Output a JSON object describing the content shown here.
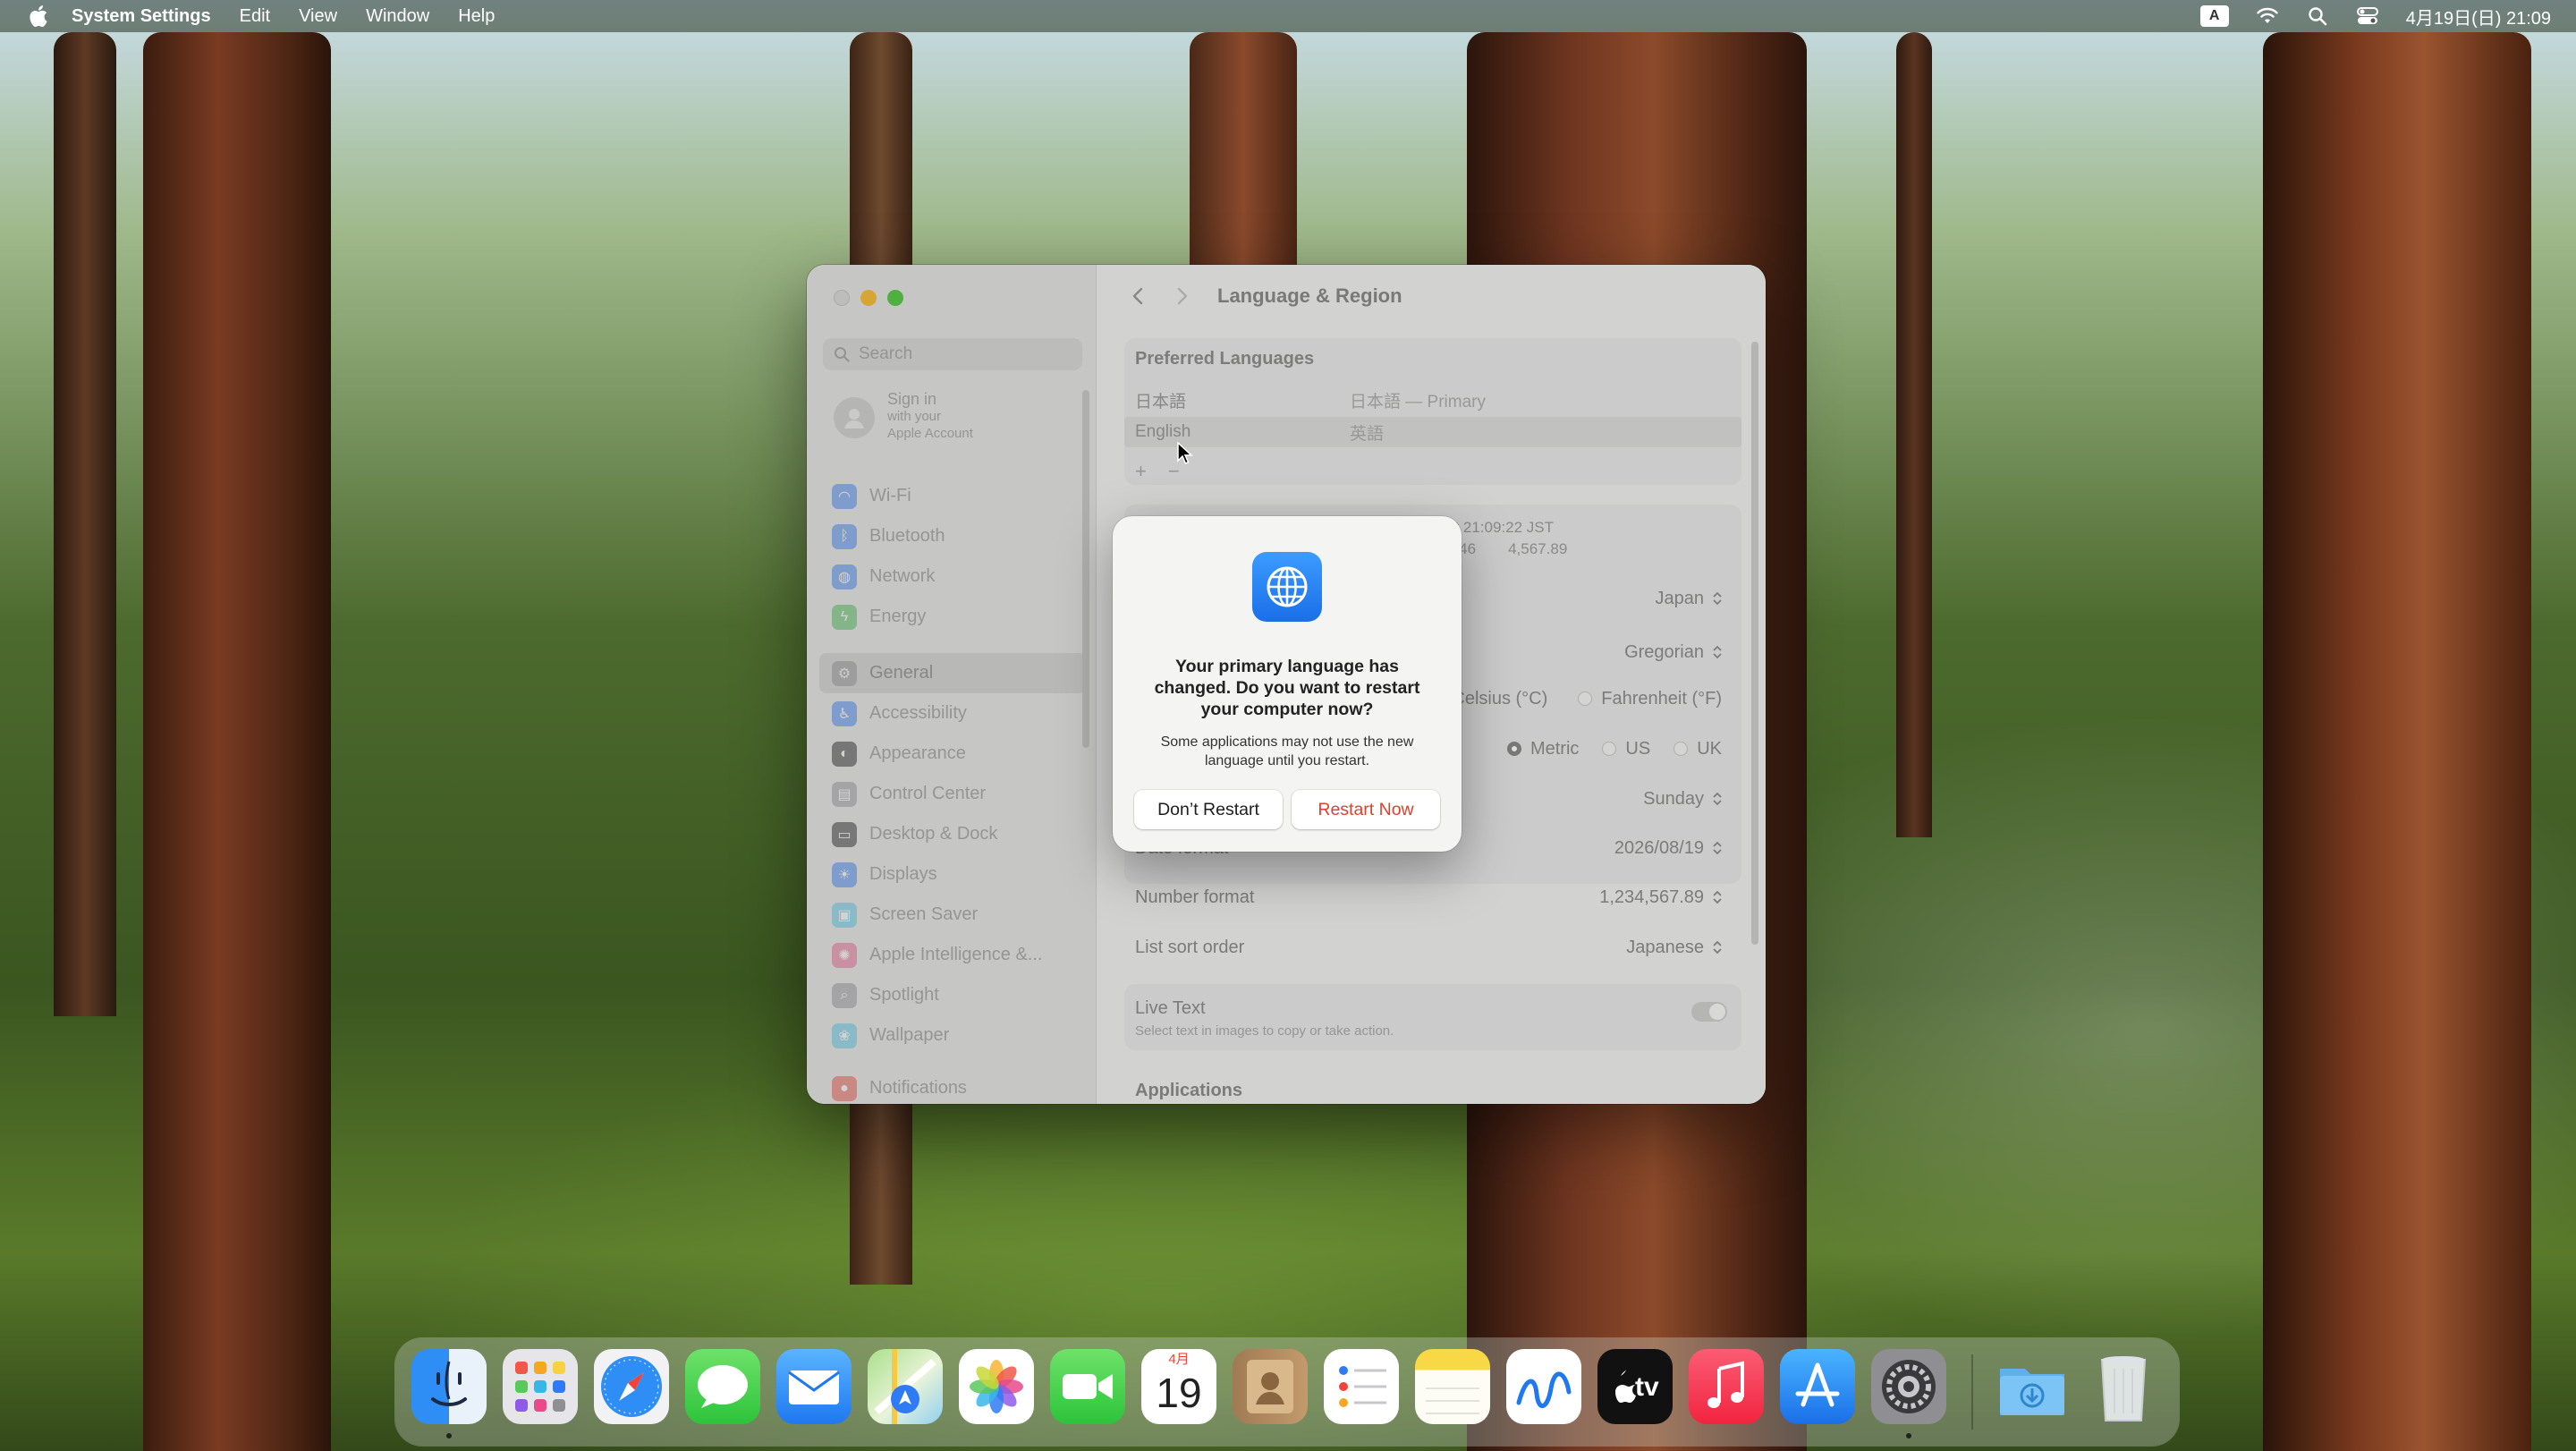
{
  "menubar": {
    "app_name": "System Settings",
    "menus": [
      "Edit",
      "View",
      "Window",
      "Help"
    ],
    "ime_label": "A",
    "clock": "4月19日(日)  21:09"
  },
  "sidebar": {
    "search_placeholder": "Search",
    "account": {
      "title": "Sign in",
      "sub1": "with your",
      "sub2": "Apple Account"
    },
    "items": [
      {
        "label": "Wi-Fi",
        "color": "#2f7bf5"
      },
      {
        "label": "Bluetooth",
        "color": "#2f7bf5"
      },
      {
        "label": "Network",
        "color": "#2f7bf5"
      },
      {
        "label": "Energy",
        "color": "#3cb84a"
      },
      {
        "label": "General",
        "color": "#8e8e93"
      },
      {
        "label": "Accessibility",
        "color": "#2f7bf5"
      },
      {
        "label": "Appearance",
        "color": "#1c1c1e"
      },
      {
        "label": "Control Center",
        "color": "#8e8e93"
      },
      {
        "label": "Desktop & Dock",
        "color": "#1c1c1e"
      },
      {
        "label": "Displays",
        "color": "#2f7bf5"
      },
      {
        "label": "Screen Saver",
        "color": "#4cc3e8"
      },
      {
        "label": "Apple Intelligence &...",
        "color": "#e85a8a"
      },
      {
        "label": "Spotlight",
        "color": "#8e8e93"
      },
      {
        "label": "Wallpaper",
        "color": "#4cc3e8"
      },
      {
        "label": "Notifications",
        "color": "#e8453a"
      }
    ]
  },
  "content": {
    "title": "Language & Region",
    "preferred_languages_heading": "Preferred Languages",
    "languages": [
      {
        "name": "日本語",
        "detail": "日本語 — Primary"
      },
      {
        "name": "English",
        "detail": "英語"
      }
    ],
    "add_label": "+",
    "remove_label": "−",
    "preview_line1": "at 21:09:22 JST",
    "preview_line2a": ",346",
    "preview_line2b": "4,567.89",
    "region_value": "Japan",
    "calendar_value": "Gregorian",
    "temperature_options": [
      "Celsius (°C)",
      "Fahrenheit (°F)"
    ],
    "measurement_options": [
      "Metric",
      "US",
      "UK"
    ],
    "first_day_value": "Sunday",
    "date_format_label": "Date format",
    "date_format_value": "2026/08/19",
    "number_format_label": "Number format",
    "number_format_value": "1,234,567.89",
    "list_sort_label": "List sort order",
    "list_sort_value": "Japanese",
    "live_text_label": "Live Text",
    "live_text_desc": "Select text in images to copy or take action.",
    "applications_heading": "Applications"
  },
  "dialog": {
    "title": "Your primary language has changed. Do you want to restart your computer now?",
    "message": "Some applications may not use the new language until you restart.",
    "cancel_label": "Don’t Restart",
    "confirm_label": "Restart Now"
  },
  "dock": {
    "apps": [
      "Finder",
      "Launchpad",
      "Safari",
      "Messages",
      "Mail",
      "Maps",
      "Photos",
      "FaceTime",
      "Calendar",
      "Contacts",
      "Reminders",
      "Notes",
      "Freeform",
      "TV",
      "Music",
      "App Store",
      "System Settings",
      "Downloads",
      "Trash"
    ],
    "calendar_month": "4月",
    "calendar_day": "19",
    "tv_label": "tv"
  }
}
